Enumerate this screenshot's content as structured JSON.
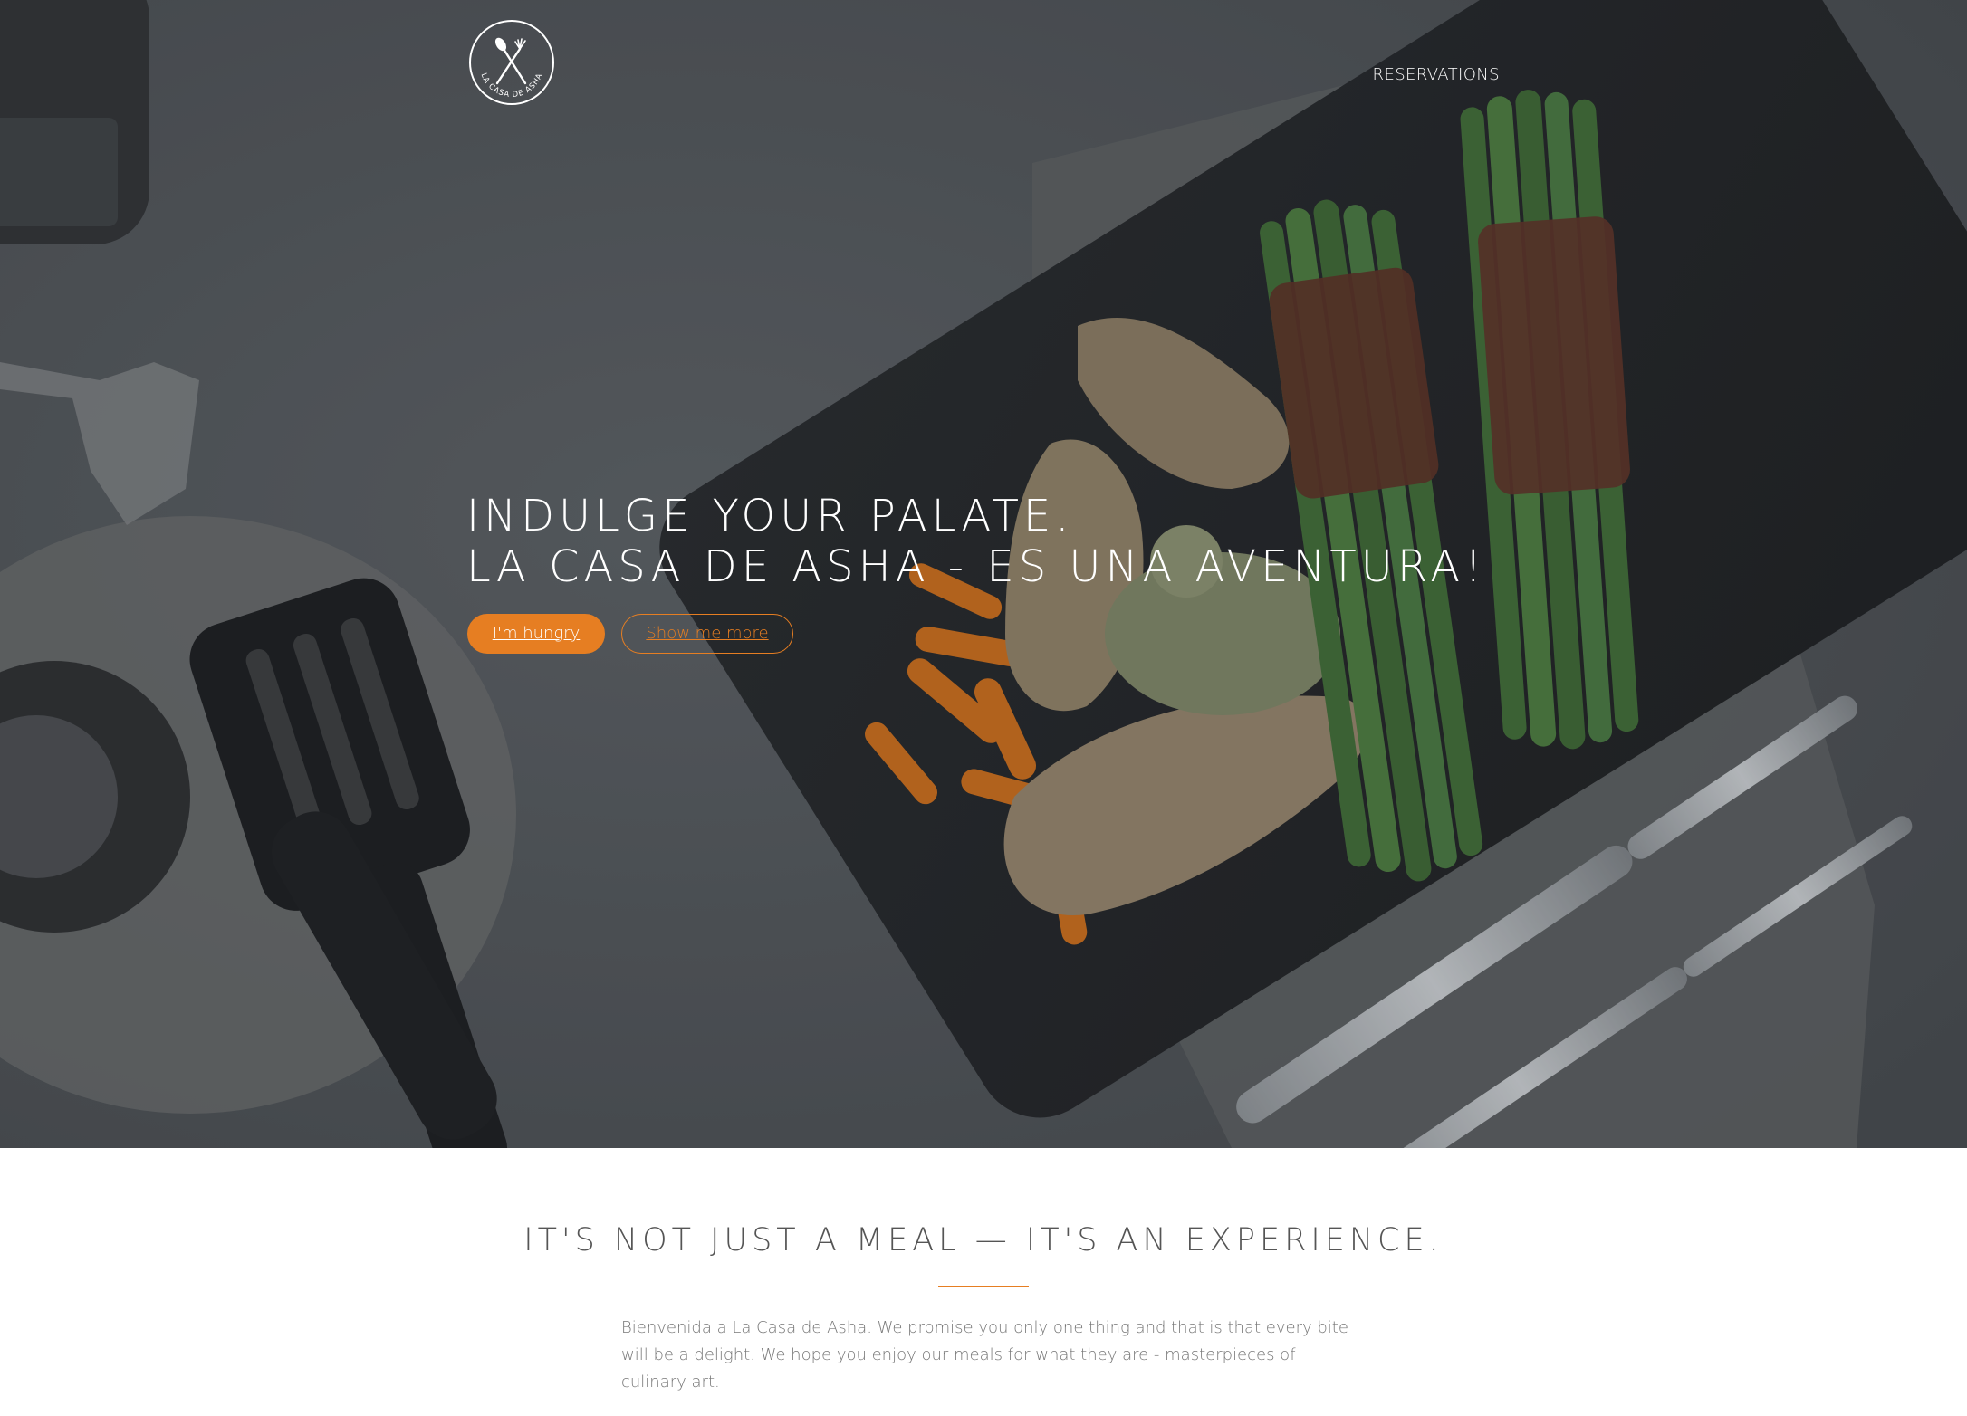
{
  "brand": {
    "logo_text": "LA CASA DE ASHA"
  },
  "nav": {
    "reservations": "RESERVATIONS"
  },
  "hero": {
    "headline_line1": "INDULGE YOUR PALATE.",
    "headline_line2": "LA CASA DE ASHA - ES UNA AVENTURA!",
    "primary_button": "I'm hungry",
    "secondary_button": "Show me more"
  },
  "intro": {
    "title": "IT'S NOT JUST A MEAL — IT'S AN EXPERIENCE.",
    "body": "Bienvenida a La Casa de Asha. We promise you only one thing and that is that every bite will be a delight. We hope you enjoy our meals for what they are - masterpieces of culinary art."
  },
  "colors": {
    "accent": "#e67e22",
    "hero_overlay": "#3f4247",
    "heading_text": "#555555",
    "body_text": "#777777"
  },
  "icons": {
    "logo": "fork-spoon-cross-icon"
  }
}
